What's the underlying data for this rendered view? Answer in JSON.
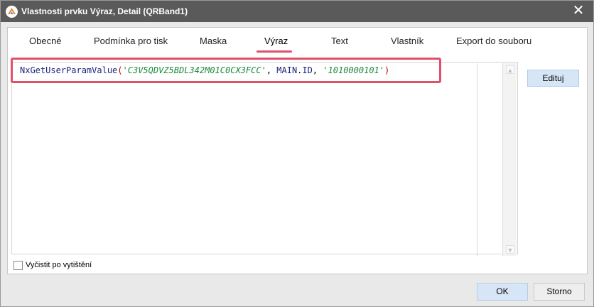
{
  "window": {
    "title": "Vlastnosti prvku Výraz, Detail (QRBand1)",
    "close_glyph": "✕",
    "app_icon": "app-logo-icon",
    "accent_color": "#e0506a"
  },
  "tabs": [
    {
      "label": "Obecné",
      "active": false
    },
    {
      "label": "Podmínka pro tisk",
      "active": false
    },
    {
      "label": "Maska",
      "active": false
    },
    {
      "label": "Výraz",
      "active": true
    },
    {
      "label": "Text",
      "active": false
    },
    {
      "label": "Vlastník",
      "active": false
    },
    {
      "label": "Export do souboru",
      "active": false
    }
  ],
  "editor": {
    "fn_name": "NxGetUserParamValue",
    "open_paren": "(",
    "arg1": "'C3V5QDVZ5BDL342M01C0CX3FCC'",
    "sep1": ", ",
    "arg2_obj": "MAIN",
    "arg2_dot": ".",
    "arg2_field": "ID",
    "sep2": ", ",
    "arg3": "'1010000101'",
    "close_paren": ")"
  },
  "buttons": {
    "edit": "Edituj",
    "ok": "OK",
    "cancel": "Storno"
  },
  "checkbox": {
    "label": "Vyčistit po vytištění",
    "checked": false
  }
}
